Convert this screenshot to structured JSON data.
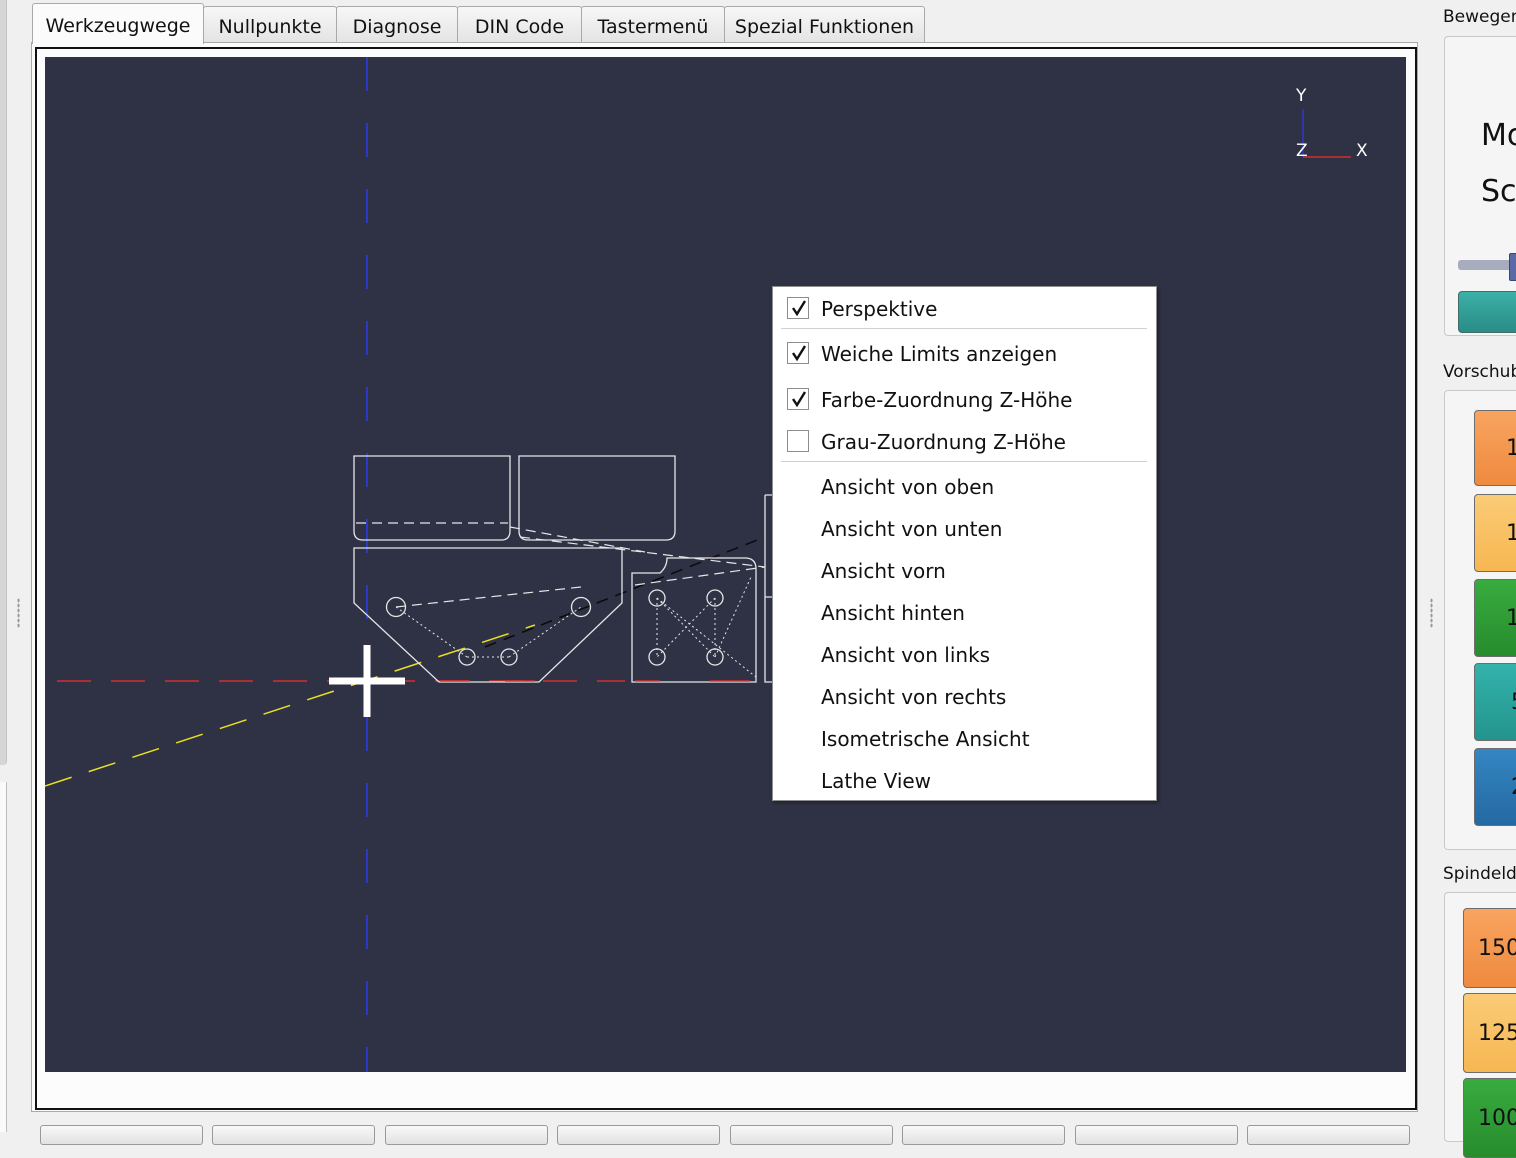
{
  "tabs": [
    {
      "label": "Werkzeugwege",
      "active": true
    },
    {
      "label": "Nullpunkte"
    },
    {
      "label": "Diagnose"
    },
    {
      "label": "DIN Code"
    },
    {
      "label": "Tastermenü"
    },
    {
      "label": "Spezial Funktionen"
    }
  ],
  "axes": {
    "y": "Y",
    "z": "Z",
    "x": "X"
  },
  "context_menu": {
    "perspective": {
      "label": "Perspektive",
      "checked": true
    },
    "soft_limits": {
      "label": "Weiche Limits anzeigen",
      "checked": true
    },
    "color_z": {
      "label": "Farbe-Zuordnung Z-Höhe",
      "checked": true
    },
    "gray_z": {
      "label": "Grau-Zuordnung Z-Höhe",
      "checked": false
    },
    "views": [
      "Ansicht von oben",
      "Ansicht von unten",
      "Ansicht vorn",
      "Ansicht hinten",
      "Ansicht von links",
      "Ansicht von rechts",
      "Isometrische Ansicht",
      "Lathe View"
    ]
  },
  "right_panel": {
    "movement_label": "Bewegen",
    "mo_text": "Mo",
    "sc_text": "Sc",
    "feed_label": "Vorschub",
    "feed_buttons": [
      "1",
      "1",
      "1",
      "5",
      "2"
    ],
    "spindle_label": "Spindeld",
    "spindle_buttons": [
      "150",
      "125",
      "100"
    ]
  },
  "colors": {
    "canvas": "#2f3245",
    "orange": "#f5964f",
    "light_orange": "#f9c067",
    "green": "#2f9e35",
    "teal": "#2aa59e",
    "blue": "#2c79b3"
  }
}
